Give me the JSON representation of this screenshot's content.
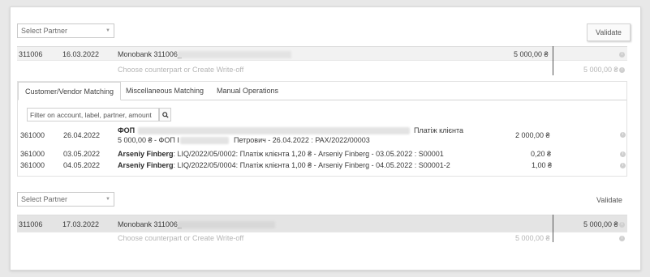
{
  "block1": {
    "select_partner": "Select Partner",
    "validate_label": "Validate",
    "line": {
      "account": "311006",
      "date": "16.03.2022",
      "label": "Monobank 311006_",
      "amount": "5 000,00 ₴"
    },
    "placeholder": "Choose counterpart or Create Write-off",
    "placeholder_amount": "5 000,00 ₴"
  },
  "tabs": [
    {
      "label": "Customer/Vendor Matching"
    },
    {
      "label": "Miscellaneous Matching"
    },
    {
      "label": "Manual Operations"
    }
  ],
  "filter_placeholder": "Filter on account, label, partner, amount",
  "matches": [
    {
      "account": "361000",
      "date": "26.04.2022",
      "partner": "ФОП",
      "desc_tail": "Платіж клієнта",
      "line2_amount": "5 000,00 ₴ - ФОП І",
      "line2_rest": "Петрович - 26.04.2022 : PAX/2022/00003",
      "amount": "2 000,00 ₴"
    },
    {
      "account": "361000",
      "date": "03.05.2022",
      "partner": "Arseniy Finberg",
      "desc": ": LIQ/2022/05/0002: Платіж клієнта 1,20 ₴ - Arseniy Finberg - 03.05.2022 : S00001",
      "amount": "0,20 ₴"
    },
    {
      "account": "361000",
      "date": "04.05.2022",
      "partner": "Arseniy Finberg",
      "desc": ": LIQ/2022/05/0004: Платіж клієнта 1,00 ₴ - Arseniy Finberg - 04.05.2022 : S00001-2",
      "amount": "1,00 ₴"
    }
  ],
  "block2": {
    "select_partner": "Select Partner",
    "validate_label": "Validate",
    "line": {
      "account": "311006",
      "date": "17.03.2022",
      "label": "Monobank 311006_",
      "amount": "5 000,00 ₴"
    },
    "placeholder": "Choose counterpart or Create Write-off",
    "placeholder_amount": "5 000,00 ₴"
  },
  "icons": {
    "info": "info-icon",
    "search": "search-icon",
    "caret": "chevron-down-icon"
  }
}
